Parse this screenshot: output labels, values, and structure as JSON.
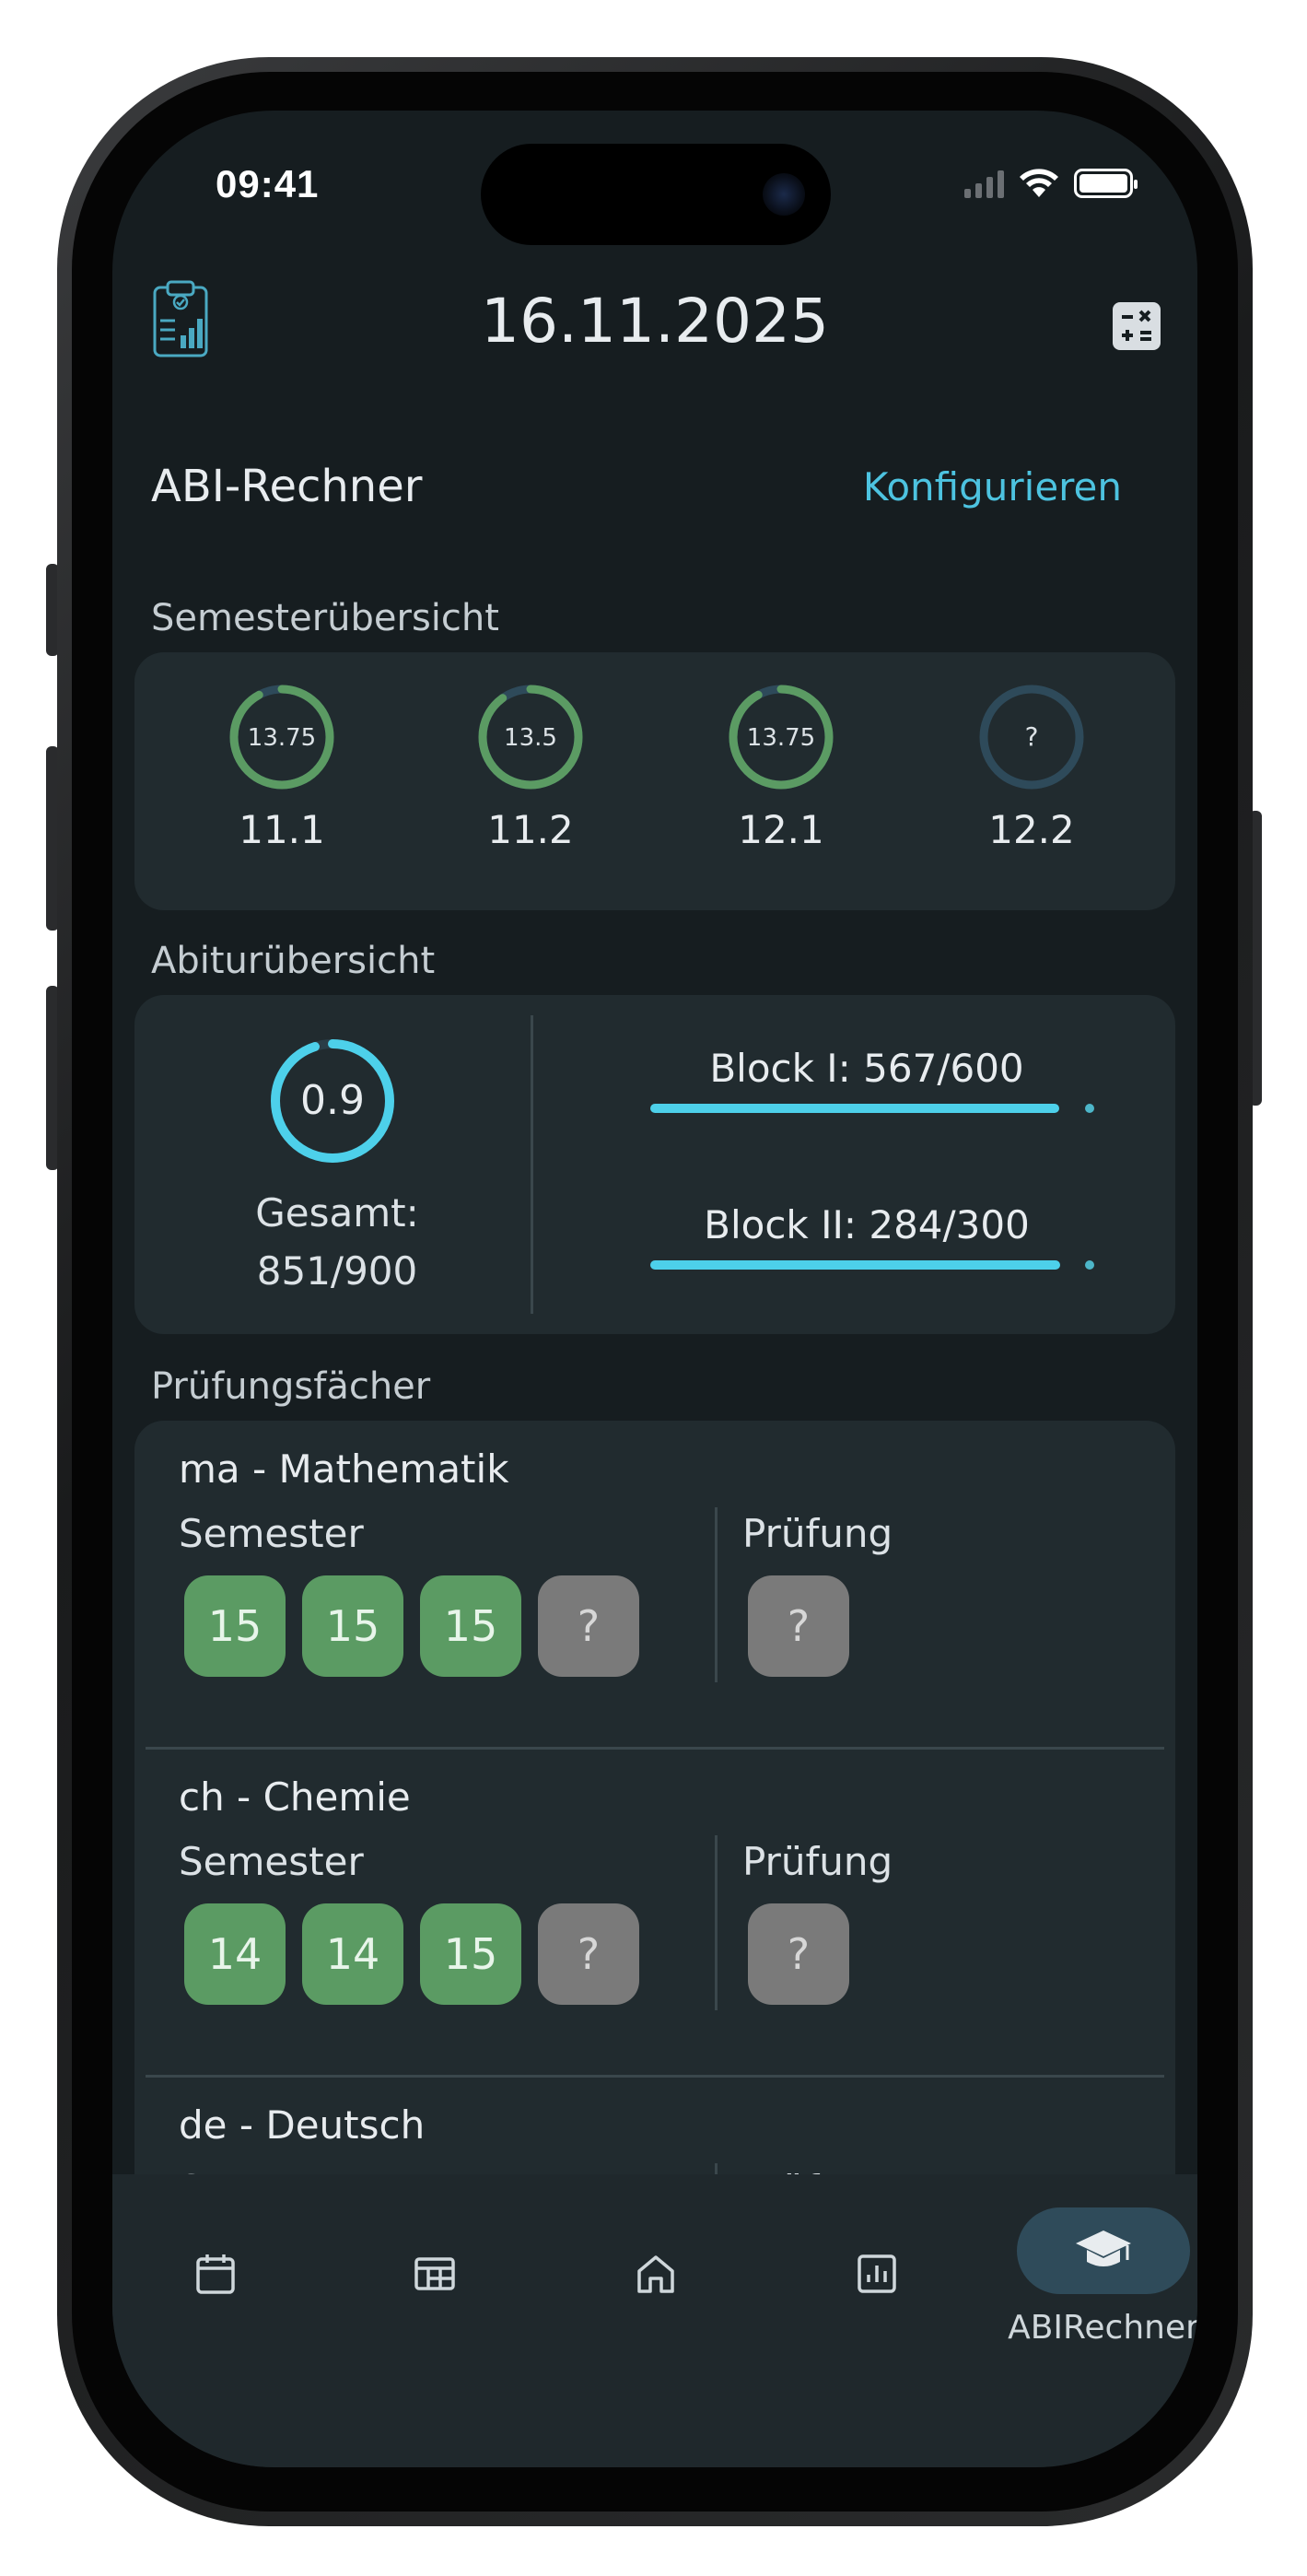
{
  "status_bar": {
    "time": "09:41"
  },
  "header": {
    "date": "16.11.2025",
    "left_icon": "clipboard-chart-icon",
    "right_icon": "calculator-icon"
  },
  "abi": {
    "title": "ABI-Rechner",
    "configure_label": "Konfigurieren"
  },
  "semester_overview": {
    "label": "Semesterübersicht",
    "items": [
      {
        "value": "13.75",
        "name": "11.1",
        "progress": 0.92,
        "color": "#5b9b63"
      },
      {
        "value": "13.5",
        "name": "11.2",
        "progress": 0.9,
        "color": "#5b9b63"
      },
      {
        "value": "13.75",
        "name": "12.1",
        "progress": 0.92,
        "color": "#5b9b63"
      },
      {
        "value": "?",
        "name": "12.2",
        "progress": 0,
        "color": "#2e4a5a"
      }
    ]
  },
  "abitur_overview": {
    "label": "Abiturübersicht",
    "grade": "0.9",
    "grade_progress": 0.95,
    "total_label": "Gesamt:",
    "total_value": "851/900",
    "blocks": [
      {
        "label": "Block I: 567/600",
        "fraction": 0.945
      },
      {
        "label": "Block II: 284/300",
        "fraction": 0.947
      }
    ],
    "accent_color": "#4dd0ea"
  },
  "exam_subjects": {
    "label": "Prüfungsfächer",
    "semester_label": "Semester",
    "exam_label": "Prüfung",
    "subjects": [
      {
        "name": "ma - Mathematik",
        "grades": [
          "15",
          "15",
          "15",
          "?"
        ],
        "exam": "?"
      },
      {
        "name": "ch - Chemie",
        "grades": [
          "14",
          "14",
          "15",
          "?"
        ],
        "exam": "?"
      },
      {
        "name": "de - Deutsch",
        "grades": [],
        "exam": ""
      }
    ]
  },
  "bottom_nav": {
    "items": [
      {
        "icon": "calendar-icon"
      },
      {
        "icon": "timetable-icon"
      },
      {
        "icon": "home-icon"
      },
      {
        "icon": "chart-icon"
      },
      {
        "icon": "graduation-cap-icon",
        "label": "ABIRechner",
        "active": true
      }
    ]
  }
}
